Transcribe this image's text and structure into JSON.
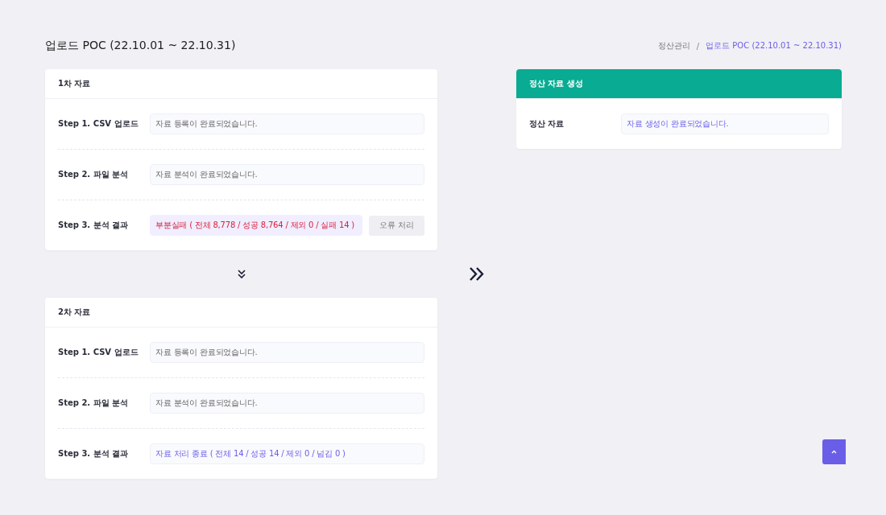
{
  "page_title": "업로드 POC (22.10.01 ~ 22.10.31)",
  "breadcrumb": [
    {
      "label": "정산관리",
      "selected": false
    },
    {
      "separator": "/",
      "label": "업로드 POC (22.10.01 ~ 22.10.31)",
      "selected": true
    }
  ],
  "cards": [
    {
      "title": "1차 자료",
      "steps": [
        {
          "label": "Step 1. CSV 업로드",
          "value": "자료 등록이 완료되었습니다.",
          "kind": "normal"
        },
        {
          "label": "Step 2. 파일 분석",
          "value": "자료 분석이 완료되었습니다.",
          "kind": "normal"
        },
        {
          "label": "Step 3. 분석 결과",
          "value": "부분실패 ( 전체 8,778 / 성공 8,764 / 제외 0 / 실패 14 )",
          "kind": "error",
          "action": {
            "label": "오류 처리",
            "disabled": true
          }
        }
      ]
    },
    {
      "title": "2차 자료",
      "steps": [
        {
          "label": "Step 1. CSV 업로드",
          "value": "자료 등록이 완료되었습니다.",
          "kind": "normal"
        },
        {
          "label": "Step 2. 파일 분석",
          "value": "자료 분석이 완료되었습니다.",
          "kind": "normal"
        },
        {
          "label": "Step 3. 분석 결과",
          "value": "자료 처리 종료 ( 전체 14 / 성공 14 / 제외 0 / 넘김 0 )",
          "kind": "info"
        }
      ]
    }
  ],
  "result_card": {
    "title": "정산 자료 생성",
    "steps": [
      {
        "label": "정산 자료",
        "value": "자료 생성이 완료되었습니다.",
        "kind": "info"
      }
    ]
  }
}
